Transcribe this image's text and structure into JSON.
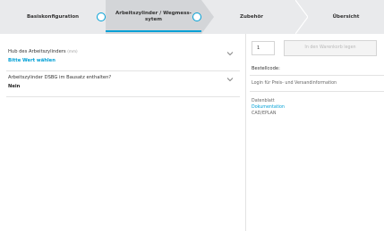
{
  "stepper": {
    "steps": [
      {
        "label": "Basiskonfiguration"
      },
      {
        "label": "Arbeitszylinder / Wegmess-\nsytem"
      },
      {
        "label": "Zubehör"
      },
      {
        "label": "Übersicht"
      }
    ]
  },
  "config": {
    "rows": [
      {
        "label": "Hub des Arbeitszylinders",
        "unit": "(mm)",
        "value": "Bitte Wert wählen"
      },
      {
        "label": "Arbeitszylinder DSBG im Bausatz enthalten?",
        "unit": "",
        "value": "Nein"
      }
    ]
  },
  "order": {
    "quantity": "1",
    "add_to_cart_label": "In den Warenkorb legen",
    "order_code_label": "Bestellcode:",
    "login_text": "Login für Preis- und Versandinformation",
    "datasheet_label": "Datenblatt",
    "documentation_label": "Dokumentation",
    "cad_label": "CAD/EPLAN"
  },
  "colors": {
    "accent": "#00a0d6",
    "stepper_bg": "#e9eaec",
    "active_step_bg": "#d3d5d8"
  }
}
